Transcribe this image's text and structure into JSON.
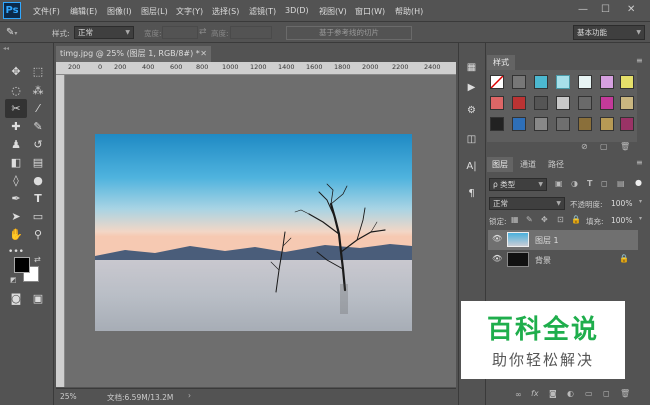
{
  "app": {
    "logo": "Ps"
  },
  "menu": [
    "文件(F)",
    "编辑(E)",
    "图像(I)",
    "图层(L)",
    "文字(Y)",
    "选择(S)",
    "滤镜(T)",
    "3D(D)",
    "视图(V)",
    "窗口(W)",
    "帮助(H)"
  ],
  "window_controls": {
    "minimize": "—",
    "maximize": "☐",
    "close": "✕"
  },
  "options": {
    "style_label": "样式:",
    "style_value": "正常",
    "width_label": "宽度:",
    "height_label": "高度:",
    "slice_button": "基于参考线的切片",
    "workspace": "基本功能"
  },
  "document": {
    "tab_title": "timg.jpg @ 25% (图层 1, RGB/8#) *",
    "ruler_ticks": [
      "200",
      "0",
      "200",
      "400",
      "600",
      "800",
      "1000",
      "1200",
      "1400",
      "1600",
      "1800",
      "2000",
      "2200",
      "2400"
    ],
    "zoom": "25%",
    "doc_info": "文档:6.59M/13.2M"
  },
  "styles_panel": {
    "tab": "样式"
  },
  "layers_panel": {
    "tabs": [
      "图层",
      "通道",
      "路径"
    ],
    "filter_kind": "ρ 类型",
    "blend_mode": "正常",
    "opacity_label": "不透明度:",
    "opacity_value": "100%",
    "lock_label": "锁定:",
    "fill_label": "填充:",
    "fill_value": "100%",
    "layers": [
      {
        "name": "图层 1",
        "selected": true
      },
      {
        "name": "背景",
        "selected": false
      }
    ]
  },
  "watermark": {
    "title": "百科全说",
    "subtitle": "助你轻松解决"
  },
  "colors": {
    "accent": "#31a8ff",
    "watermark_green": "#1fae4c"
  }
}
